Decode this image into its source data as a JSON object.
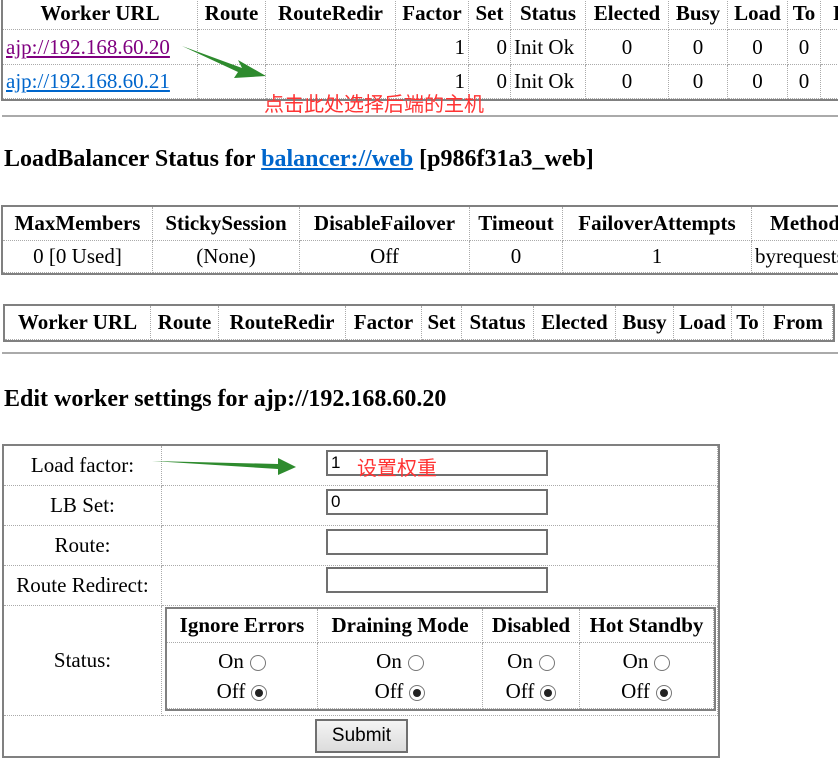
{
  "workers_table": {
    "headers": [
      "Worker URL",
      "Route",
      "RouteRedir",
      "Factor",
      "Set",
      "Status",
      "Elected",
      "Busy",
      "Load",
      "To",
      "F"
    ],
    "rows": [
      [
        "ajp://192.168.60.20",
        "",
        "",
        "1",
        "0",
        "Init Ok",
        "0",
        "0",
        "0",
        "0",
        ""
      ],
      [
        "ajp://192.168.60.21",
        "",
        "",
        "1",
        "0",
        "Init Ok",
        "0",
        "0",
        "0",
        "0",
        ""
      ]
    ]
  },
  "annotation_click": "点击此处选择后端的主机",
  "lb_heading": {
    "prefix": "LoadBalancer Status for ",
    "link": "balancer://web",
    "suffix": " [p986f31a3_web]"
  },
  "lb_table": {
    "headers": [
      "MaxMembers",
      "StickySession",
      "DisableFailover",
      "Timeout",
      "FailoverAttempts",
      "Method"
    ],
    "row": [
      "0 [0 Used]",
      "(None)",
      "Off",
      "0",
      "1",
      "byrequests"
    ]
  },
  "lb_workers_headers": [
    "Worker URL",
    "Route",
    "RouteRedir",
    "Factor",
    "Set",
    "Status",
    "Elected",
    "Busy",
    "Load",
    "To",
    "From"
  ],
  "edit_heading": "Edit worker settings for ajp://192.168.60.20",
  "form": {
    "load_factor_label": "Load factor:",
    "load_factor_value": "1",
    "annotation_weight": "设置权重",
    "lb_set_label": "LB Set:",
    "lb_set_value": "0",
    "route_label": "Route:",
    "route_value": "",
    "route_redirect_label": "Route Redirect:",
    "route_redirect_value": "",
    "status_label": "Status:",
    "status_headers": [
      "Ignore Errors",
      "Draining Mode",
      "Disabled",
      "Hot Standby"
    ],
    "on_label": "On",
    "off_label": "Off",
    "submit": "Submit"
  },
  "colors": {
    "visited_link": "#800080",
    "link": "#0066cc",
    "annotation": "#ff3333",
    "arrow": "#2e8b2e"
  }
}
